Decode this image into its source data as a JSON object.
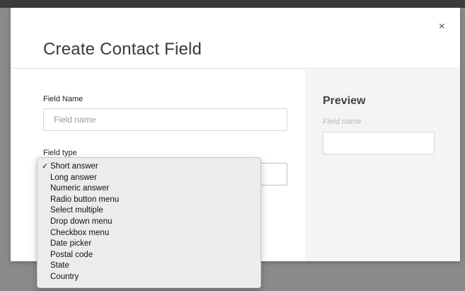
{
  "modal": {
    "title": "Create Contact Field",
    "close_glyph": "×",
    "close_icon": "close-icon"
  },
  "form": {
    "field_name_label": "Field Name",
    "field_name_placeholder": "Field name",
    "field_name_value": "",
    "field_type_label": "Field type",
    "field_type_selected": "Short answer"
  },
  "preview": {
    "title": "Preview",
    "field_label": "Field name"
  },
  "dropdown": {
    "check_glyph": "✓",
    "options": [
      "Short answer",
      "Long answer",
      "Numeric answer",
      "Radio button menu",
      "Select multiple",
      "Drop down menu",
      "Checkbox menu",
      "Date picker",
      "Postal code",
      "State",
      "Country"
    ]
  },
  "colors": {
    "overlay": "#8a8a8a",
    "modal_bg": "#ffffff",
    "preview_bg": "#f4f4f4",
    "title_text": "#333a40"
  }
}
